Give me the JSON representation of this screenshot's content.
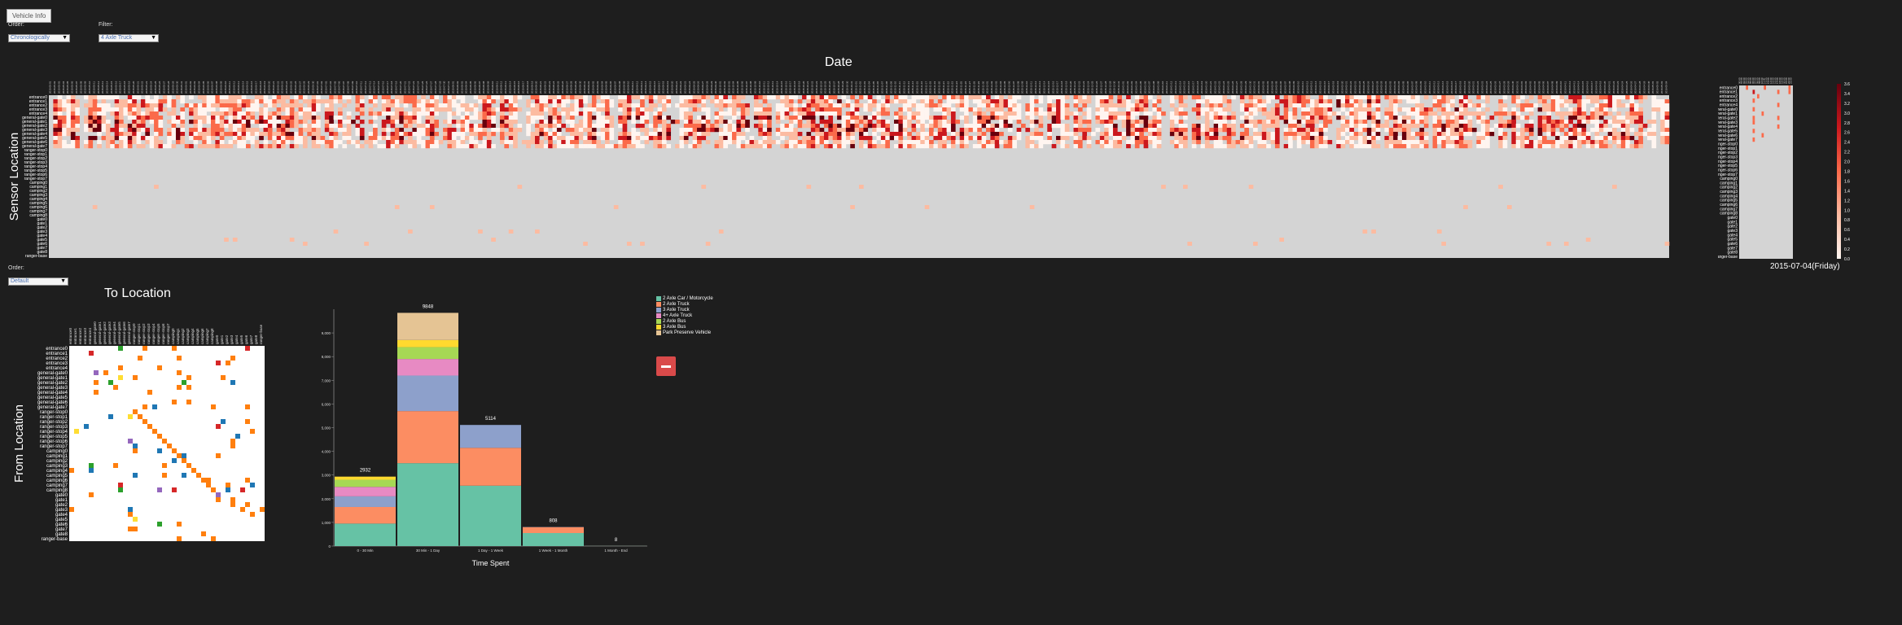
{
  "controls": {
    "vehicle_info_label": "Vehicle Info",
    "order_label": "Order:",
    "order_value": "Chronologically",
    "filter_label": "Filter:",
    "filter_value": "4 Axle Truck",
    "order2_label": "Order:",
    "order2_value": "Default"
  },
  "legend": {
    "items": [
      "2 Axle Car / Motorcycle",
      "2 Axle Truck",
      "3 Axle Truck",
      "4+ Axle Truck",
      "2 Axle Bus",
      "3 Axle Bus",
      "Park Preserve Vehicle"
    ]
  },
  "colors": {
    "bg": "#1e1e1e",
    "heatmap_empty": "#d4d4d4",
    "heatmap_ramp": [
      "#fff5f0",
      "#fcbba1",
      "#fb6a4a",
      "#cb181d",
      "#67000d"
    ],
    "stack": [
      "#66c2a5",
      "#fc8d62",
      "#8da0cb",
      "#e78ac3",
      "#a6d854",
      "#ffd92f",
      "#e5c494"
    ],
    "matrix": [
      "#ff7f0e",
      "#1f77b4",
      "#2ca02c",
      "#d62728",
      "#9467bd",
      "#ffdd33"
    ],
    "minus_button": "#d94a4a"
  },
  "icons": {
    "collapse": "minus-icon",
    "dropdown": "triangle-down-icon"
  },
  "chart_data": [
    {
      "type": "heatmap",
      "id": "date-sensor",
      "title": "Date",
      "ylabel": "Sensor Location",
      "rows": [
        "entrance0",
        "entrance1",
        "entrance2",
        "entrance3",
        "entrance4",
        "general-gate0",
        "general-gate1",
        "general-gate2",
        "general-gate3",
        "general-gate4",
        "general-gate5",
        "general-gate6",
        "general-gate7",
        "ranger-stop0",
        "ranger-stop1",
        "ranger-stop2",
        "ranger-stop3",
        "ranger-stop4",
        "ranger-stop5",
        "ranger-stop6",
        "ranger-stop7",
        "camping0",
        "camping1",
        "camping2",
        "camping3",
        "camping4",
        "camping5",
        "camping6",
        "camping7",
        "camping8",
        "gate0",
        "gate1",
        "gate2",
        "gate3",
        "gate4",
        "gate5",
        "gate6",
        "gate7",
        "gate8",
        "ranger-base"
      ],
      "active_rows": 13,
      "columns": 370,
      "date_start": "2015-05-01",
      "sparse_rows": [
        22,
        27,
        33,
        35,
        36
      ]
    },
    {
      "type": "heatmap",
      "id": "single-day",
      "title": "2015-07-04(Friday)",
      "rows_ref": "date-sensor",
      "columns": 24,
      "colorbar_ticks": [
        3.6,
        3.4,
        3.2,
        3.0,
        2.8,
        2.6,
        2.4,
        2.2,
        2.0,
        1.8,
        1.6,
        1.4,
        1.2,
        1.0,
        0.8,
        0.6,
        0.4,
        0.2,
        0.0
      ]
    },
    {
      "type": "heatmap",
      "id": "from-to",
      "title": "To Location",
      "ylabel": "From Location",
      "rows_ref": "date-sensor"
    },
    {
      "type": "bar",
      "id": "time-spent",
      "stacked": true,
      "xlabel": "Time Spent",
      "categories": [
        "0 - 30 Min",
        "30 Min - 1 Day",
        "1 Day - 1 Week",
        "1 Week - 1 Month",
        "1 Month - End"
      ],
      "totals": [
        2932,
        9848,
        5114,
        808,
        8
      ],
      "ylim": [
        0,
        10000
      ],
      "yticks": [
        0,
        1000,
        2000,
        3000,
        4000,
        5000,
        6000,
        7000,
        8000,
        9000
      ],
      "series": [
        {
          "name": "2 Axle Car / Motorcycle",
          "values": [
            950,
            3500,
            2550,
            550,
            5
          ]
        },
        {
          "name": "2 Axle Truck",
          "values": [
            700,
            2200,
            1600,
            250,
            2
          ]
        },
        {
          "name": "3 Axle Truck",
          "values": [
            450,
            1500,
            964,
            8,
            1
          ]
        },
        {
          "name": "4+ Axle Truck",
          "values": [
            400,
            700,
            0,
            0,
            0
          ]
        },
        {
          "name": "2 Axle Bus",
          "values": [
            300,
            500,
            0,
            0,
            0
          ]
        },
        {
          "name": "3 Axle Bus",
          "values": [
            132,
            300,
            0,
            0,
            0
          ]
        },
        {
          "name": "Park Preserve Vehicle",
          "values": [
            0,
            1148,
            0,
            0,
            0
          ]
        }
      ]
    }
  ]
}
